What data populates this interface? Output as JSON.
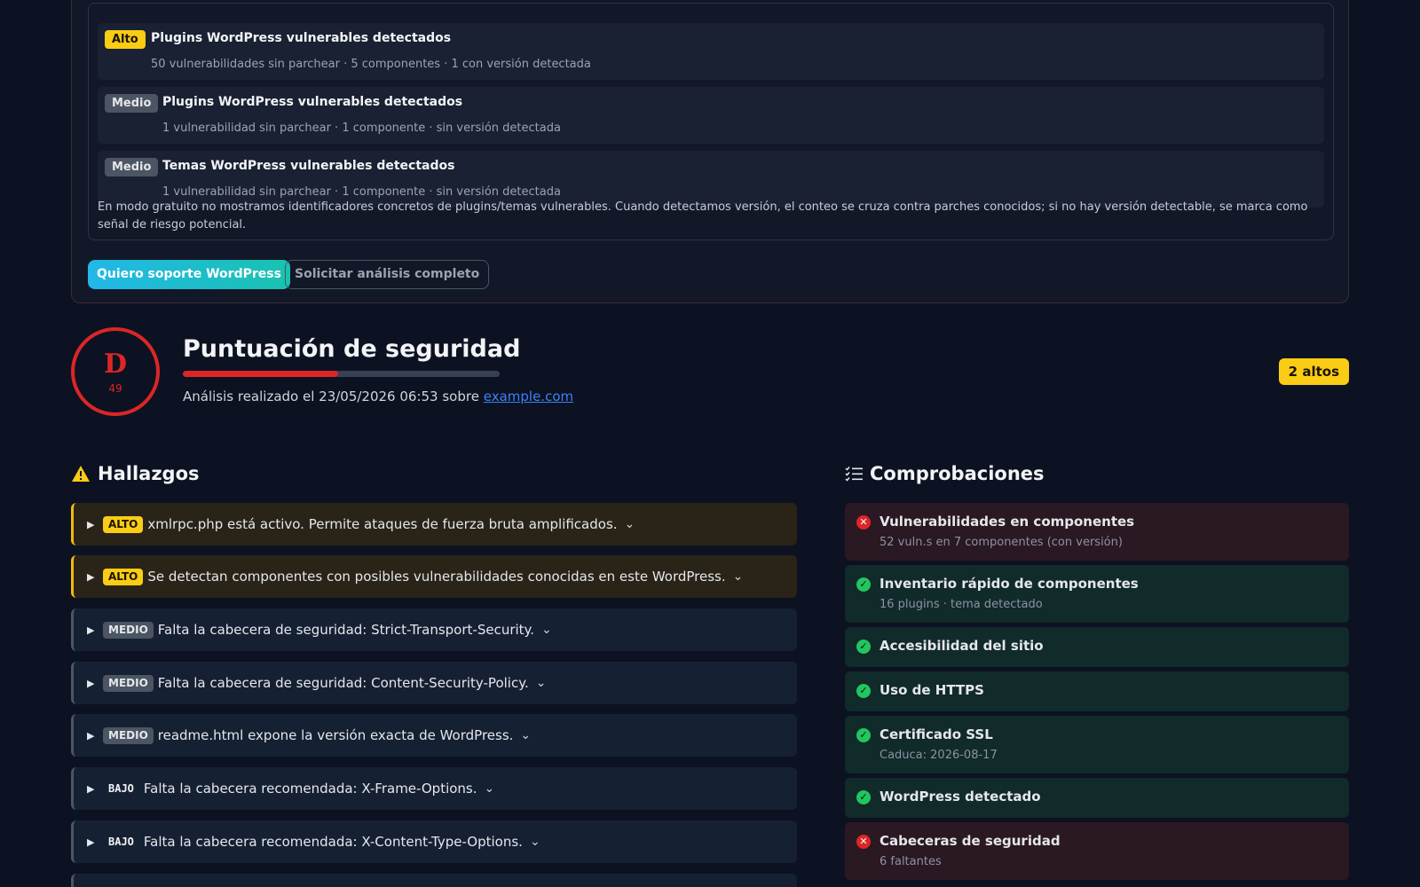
{
  "vulnerability_panel": {
    "items": [
      {
        "severity": "Alto",
        "title": "Plugins WordPress vulnerables detectados",
        "detail": "50 vulnerabilidades sin parchear · 5 componentes · 1 con versión detectada"
      },
      {
        "severity": "Medio",
        "title": "Plugins WordPress vulnerables detectados",
        "detail": "1 vulnerabilidad sin parchear · 1 componente · sin versión detectada"
      },
      {
        "severity": "Medio",
        "title": "Temas WordPress vulnerables detectados",
        "detail": "1 vulnerabilidad sin parchear · 1 componente · sin versión detectada"
      }
    ],
    "note": "En modo gratuito no mostramos identificadores concretos de plugins/temas vulnerables. Cuando detectamos versión, el conteo se cruza contra parches conocidos; si no hay versión detectable, se marca como señal de riesgo potencial.",
    "primary_button": "Quiero soporte WordPress",
    "secondary_button": "Solicitar análisis completo"
  },
  "score": {
    "grade": "D",
    "value": "49",
    "fraction": 0.49,
    "title": "Puntuación de seguridad",
    "meta_prefix": "Análisis realizado el 23/05/2026 06:53 sobre",
    "domain": "example.com",
    "altos_badge": "2 altos"
  },
  "findings": {
    "heading": "Hallazgos",
    "items": [
      {
        "severity": "ALTO",
        "level": "alto",
        "text": "xmlrpc.php está activo. Permite ataques de fuerza bruta amplificados."
      },
      {
        "severity": "ALTO",
        "level": "alto",
        "text": "Se detectan componentes con posibles vulnerabilidades conocidas en este WordPress."
      },
      {
        "severity": "MEDIO",
        "level": "medio",
        "text": "Falta la cabecera de seguridad: Strict-Transport-Security."
      },
      {
        "severity": "MEDIO",
        "level": "medio",
        "text": "Falta la cabecera de seguridad: Content-Security-Policy."
      },
      {
        "severity": "MEDIO",
        "level": "medio",
        "text": "readme.html expone la versión exacta de WordPress."
      },
      {
        "severity": "BAJO",
        "level": "bajo",
        "text": "Falta la cabecera recomendada: X-Frame-Options."
      },
      {
        "severity": "BAJO",
        "level": "bajo",
        "text": "Falta la cabecera recomendada: X-Content-Type-Options."
      }
    ]
  },
  "checks": {
    "heading": "Comprobaciones",
    "items": [
      {
        "status": "fail",
        "title": "Vulnerabilidades en componentes",
        "detail": "52 vuln.s en 7 componentes (con versión)"
      },
      {
        "status": "ok",
        "title": "Inventario rápido de componentes",
        "detail": "16 plugins · tema detectado"
      },
      {
        "status": "ok",
        "title": "Accesibilidad del sitio",
        "detail": ""
      },
      {
        "status": "ok",
        "title": "Uso de HTTPS",
        "detail": ""
      },
      {
        "status": "ok",
        "title": "Certificado SSL",
        "detail": "Caduca: 2026-08-17"
      },
      {
        "status": "ok",
        "title": "WordPress detectado",
        "detail": ""
      },
      {
        "status": "fail",
        "title": "Cabeceras de seguridad",
        "detail": "6 faltantes"
      }
    ]
  },
  "colors": {
    "background": "#0c1222",
    "alto": "#facc15",
    "danger": "#dc2626",
    "success": "#22c55e",
    "link": "#3b82f6"
  }
}
